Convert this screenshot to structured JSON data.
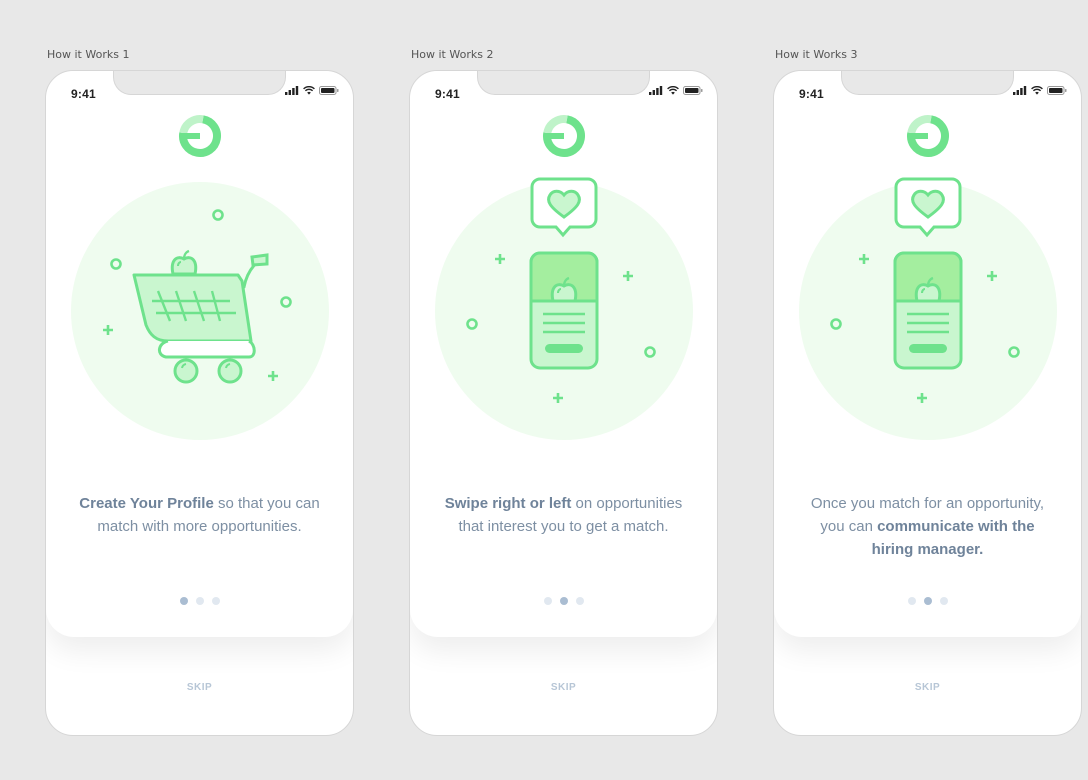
{
  "screens": [
    {
      "label": "How it Works 1",
      "time": "9:41",
      "illustration": "shopping-cart-illustration",
      "copy": [
        {
          "text": "Create Your Profile",
          "bold": true
        },
        {
          "text": " so that you can match with more opportunities.",
          "bold": false
        }
      ],
      "page_indicator": {
        "current": 1,
        "total": 3
      },
      "skip_label": "SKIP"
    },
    {
      "label": "How it Works 2",
      "time": "9:41",
      "illustration": "phone-heart-illustration",
      "copy": [
        {
          "text": "Swipe right or left",
          "bold": true
        },
        {
          "text": " on opportunities that interest you to get a match.",
          "bold": false
        }
      ],
      "page_indicator": {
        "current": 2,
        "total": 3
      },
      "skip_label": "SKIP"
    },
    {
      "label": "How it Works 3",
      "time": "9:41",
      "illustration": "phone-heart-illustration",
      "copy": [
        {
          "text": "Once you match for an opportunity, you can ",
          "bold": false
        },
        {
          "text": "communicate with the hiring manager.",
          "bold": true
        }
      ],
      "page_indicator": {
        "current": 2,
        "total": 3
      },
      "skip_label": "SKIP"
    }
  ],
  "colors": {
    "background": "#e8e8e8",
    "brand_green": "#6ee28c",
    "light_green": "#effcef",
    "fill_green": "#c9f6cf",
    "text_body": "#7d8fa3",
    "dot_active": "#aabdd2",
    "dot_inactive": "#e1e8f0",
    "skip": "#b7c6d6"
  },
  "icons": [
    "signal-icon",
    "wifi-icon",
    "battery-icon",
    "brand-logo"
  ]
}
